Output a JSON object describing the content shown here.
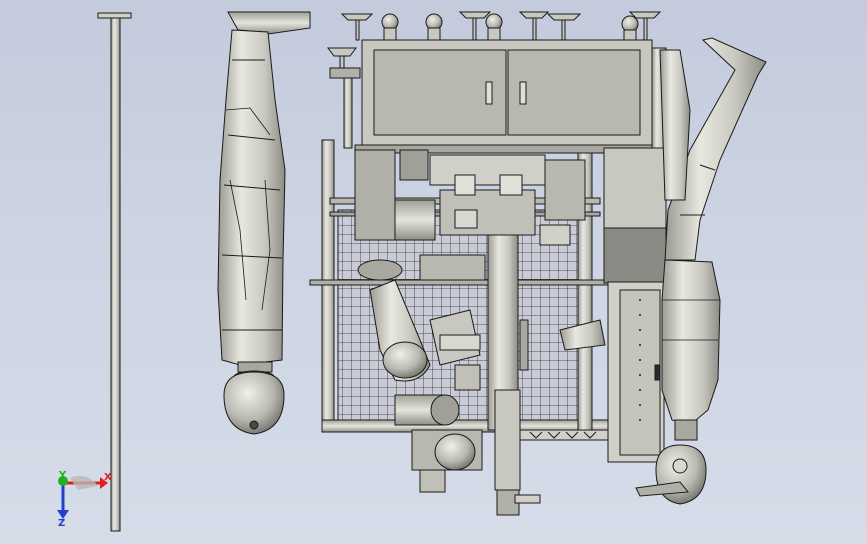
{
  "viewport": {
    "background_top": "#c3cbdc",
    "background_bottom": "#d6dce8"
  },
  "triad": {
    "x_label": "X",
    "y_label": "Y",
    "z_label": "Z",
    "x_color": "#e02020",
    "y_color": "#20b020",
    "z_color": "#2040d0"
  },
  "model": {
    "body_color": "#d4d4cc",
    "shade_color": "#9e9e96",
    "edge_color": "#1a1a1a",
    "dark_panel_color": "#8a8a84"
  }
}
